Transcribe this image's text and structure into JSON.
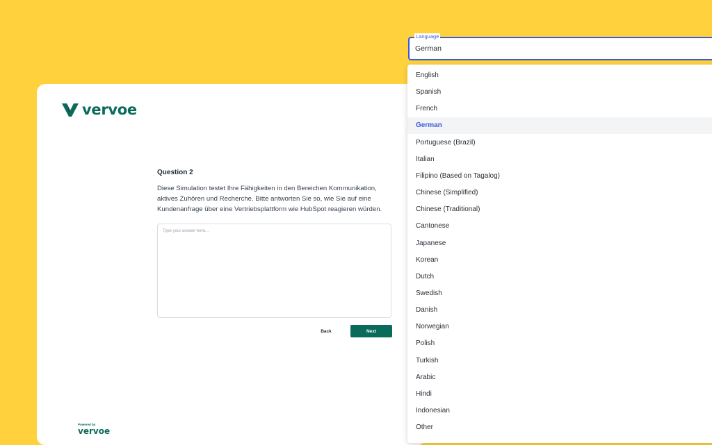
{
  "brand": {
    "name": "vervoe",
    "color": "#0b6b5b",
    "powered_by": "Powered by"
  },
  "question": {
    "title": "Question 2",
    "text": "Diese Simulation testet Ihre Fähigkeiten in den Bereichen Kommunikation, aktives Zuhören und Recherche. Bitte antworten Sie so, wie Sie auf eine Kundenanfrage über eine Vertriebsplattform wie HubSpot reagieren würden.",
    "answer_placeholder": "Type your answer here...",
    "answer_value": ""
  },
  "actions": {
    "back_label": "Back",
    "next_label": "Next"
  },
  "language": {
    "label": "Language",
    "selected": "German",
    "options": [
      "English",
      "Spanish",
      "French",
      "German",
      "Portuguese (Brazil)",
      "Italian",
      "Filipino (Based on Tagalog)",
      "Chinese (Simplified)",
      "Chinese (Traditional)",
      "Cantonese",
      "Japanese",
      "Korean",
      "Dutch",
      "Swedish",
      "Danish",
      "Norwegian",
      "Polish",
      "Turkish",
      "Arabic",
      "Hindi",
      "Indonesian",
      "Other"
    ]
  },
  "colors": {
    "background": "#ffd23d",
    "accent": "#3b5bdb",
    "primary_button": "#0b6b5b"
  }
}
